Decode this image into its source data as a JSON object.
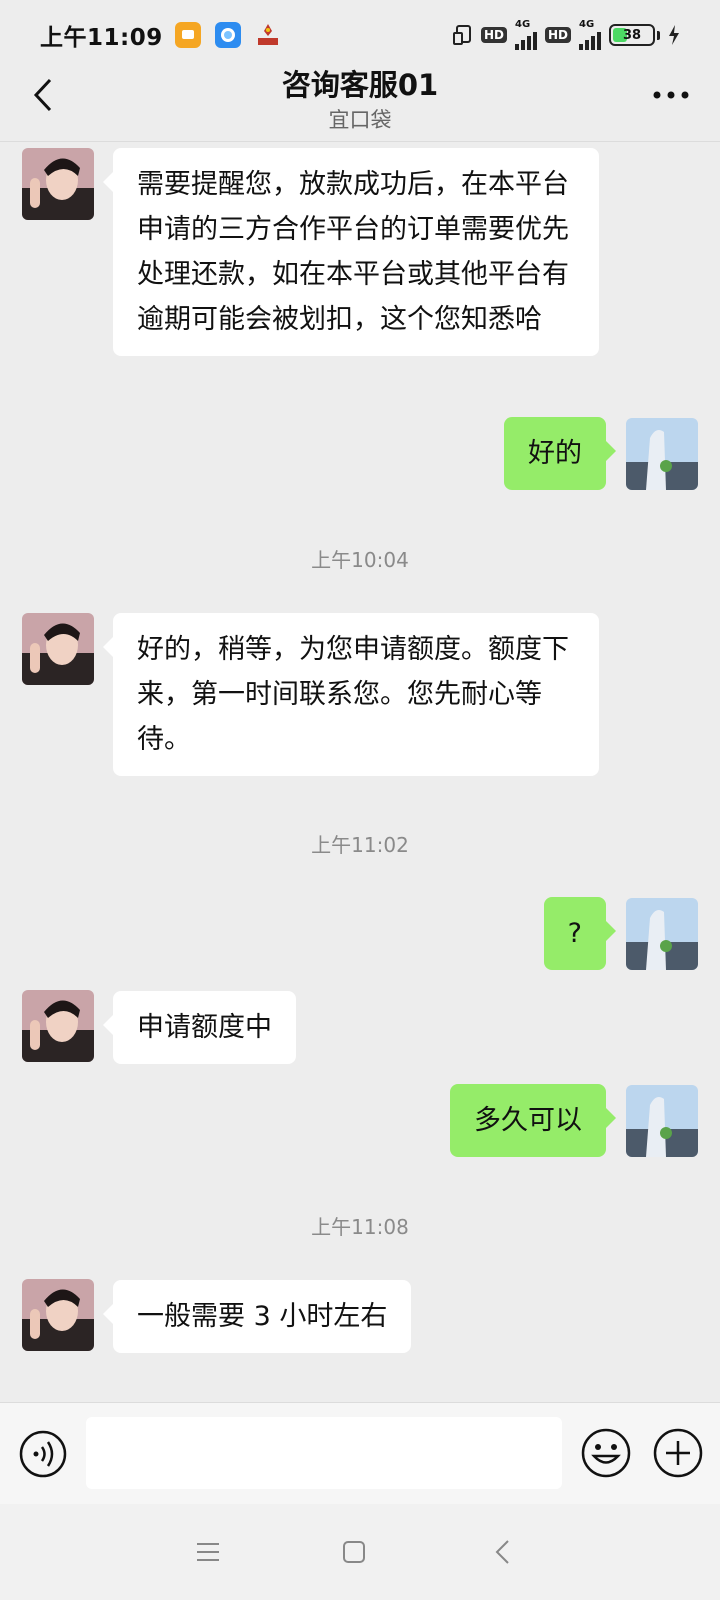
{
  "status_bar": {
    "time": "上午11:09",
    "network_1": "4G",
    "network_2": "4G",
    "hd": "HD",
    "battery_percent": 38,
    "battery_label": "38"
  },
  "header": {
    "title": "咨询客服01",
    "subtitle": "宜口袋"
  },
  "messages": [
    {
      "type": "incoming",
      "text": "需要提醒您，放款成功后，在本平台申请的三方合作平台的订单需要优先处理还款，如在本平台或其他平台有逾期可能会被划扣，这个您知悉哈"
    },
    {
      "type": "outgoing",
      "text": "好的"
    },
    {
      "type": "time",
      "text": "上午10:04"
    },
    {
      "type": "incoming",
      "text": "好的，稍等，为您申请额度。额度下来，第一时间联系您。您先耐心等待。"
    },
    {
      "type": "time",
      "text": "上午11:02"
    },
    {
      "type": "outgoing",
      "text": "?"
    },
    {
      "type": "incoming",
      "text": "申请额度中"
    },
    {
      "type": "outgoing",
      "text": "多久可以"
    },
    {
      "type": "time",
      "text": "上午11:08"
    },
    {
      "type": "incoming",
      "text": "一般需要 3 小时左右"
    }
  ],
  "input": {
    "value": "",
    "placeholder": ""
  },
  "colors": {
    "background": "#ededed",
    "outgoing_bubble": "#95ec69",
    "incoming_bubble": "#ffffff",
    "battery": "#4cd964"
  },
  "icons": [
    "back-icon",
    "more-icon",
    "voice-icon",
    "emoji-icon",
    "plus-icon",
    "menu-icon",
    "home-icon",
    "nav-back-icon"
  ]
}
